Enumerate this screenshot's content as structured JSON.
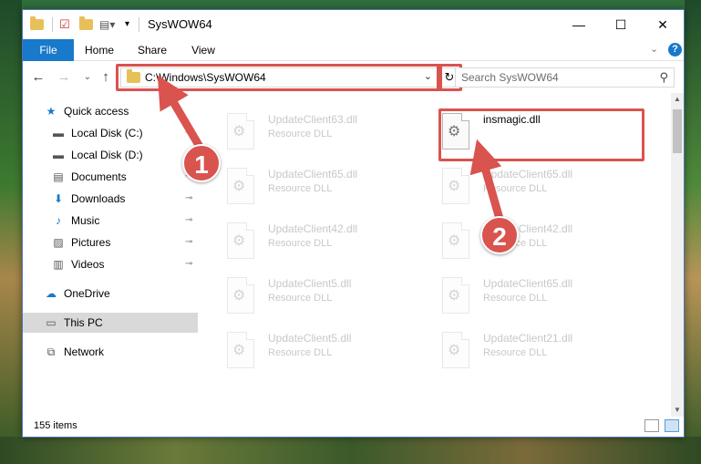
{
  "window": {
    "title": "SysWOW64",
    "controls": {
      "minimize": "—",
      "maximize": "☐",
      "close": "✕"
    }
  },
  "ribbon": {
    "tabs": [
      {
        "id": "file",
        "label": "File"
      },
      {
        "id": "home",
        "label": "Home"
      },
      {
        "id": "share",
        "label": "Share"
      },
      {
        "id": "view",
        "label": "View"
      }
    ],
    "expand_glyph": "⌄",
    "help_glyph": "?"
  },
  "navigation": {
    "back_glyph": "←",
    "forward_glyph": "→",
    "recent_glyph": "⌄",
    "up_glyph": "↑"
  },
  "address": {
    "path": "C:\\Windows\\SysWOW64",
    "chevron": "⌄",
    "refresh_glyph": "↻"
  },
  "search": {
    "placeholder": "Search SysWOW64",
    "icon_glyph": "⚲"
  },
  "nav_pane": {
    "items": [
      {
        "label": "Quick access",
        "icon": "star-icon",
        "glyph": "★",
        "pinned": false,
        "indent": false
      },
      {
        "label": "Local Disk (C:)",
        "icon": "drive-icon",
        "glyph": "▬",
        "pinned": true,
        "indent": true
      },
      {
        "label": "Local Disk (D:)",
        "icon": "drive-icon",
        "glyph": "▬",
        "pinned": false,
        "indent": true
      },
      {
        "label": "Documents",
        "icon": "documents-icon",
        "glyph": "▤",
        "pinned": true,
        "indent": true
      },
      {
        "label": "Downloads",
        "icon": "download-icon",
        "glyph": "⬇",
        "pinned": true,
        "indent": true
      },
      {
        "label": "Music",
        "icon": "music-icon",
        "glyph": "♪",
        "pinned": true,
        "indent": true
      },
      {
        "label": "Pictures",
        "icon": "pictures-icon",
        "glyph": "▨",
        "pinned": true,
        "indent": true
      },
      {
        "label": "Videos",
        "icon": "videos-icon",
        "glyph": "▥",
        "pinned": true,
        "indent": true
      },
      {
        "label": "OneDrive",
        "icon": "cloud-icon",
        "glyph": "☁",
        "pinned": false,
        "indent": false
      },
      {
        "label": "This PC",
        "icon": "computer-icon",
        "glyph": "▭",
        "pinned": false,
        "indent": false,
        "selected": true
      },
      {
        "label": "Network",
        "icon": "network-icon",
        "glyph": "⧉",
        "pinned": false,
        "indent": false
      }
    ],
    "pin_glyph": "📌"
  },
  "files": {
    "left_column": [
      {
        "name": "UpdateClient63.dll",
        "type": "Resource DLL"
      },
      {
        "name": "UpdateClient65.dll",
        "type": "Resource DLL"
      },
      {
        "name": "UpdateClient42.dll",
        "type": "Resource DLL"
      },
      {
        "name": "UpdateClient5.dll",
        "type": "Resource DLL"
      },
      {
        "name": "UpdateClient5.dll",
        "type": "Resource DLL"
      }
    ],
    "right_column": [
      {
        "name": "insmagic.dll",
        "type": "",
        "highlighted": true
      },
      {
        "name": "UpdateClient65.dll",
        "type": "Resource DLL"
      },
      {
        "name": "UpdateClient42.dll",
        "type": "Resource DLL"
      },
      {
        "name": "UpdateClient65.dll",
        "type": "Resource DLL"
      },
      {
        "name": "UpdateClient21.dll",
        "type": "Resource DLL"
      }
    ]
  },
  "status": {
    "item_count": "155 items"
  },
  "annotations": {
    "step1": "1",
    "step2": "2",
    "color": "#d9534f"
  },
  "colors": {
    "accent": "#1979ca",
    "selection": "#d9d9d9",
    "highlight": "#d9534f"
  }
}
